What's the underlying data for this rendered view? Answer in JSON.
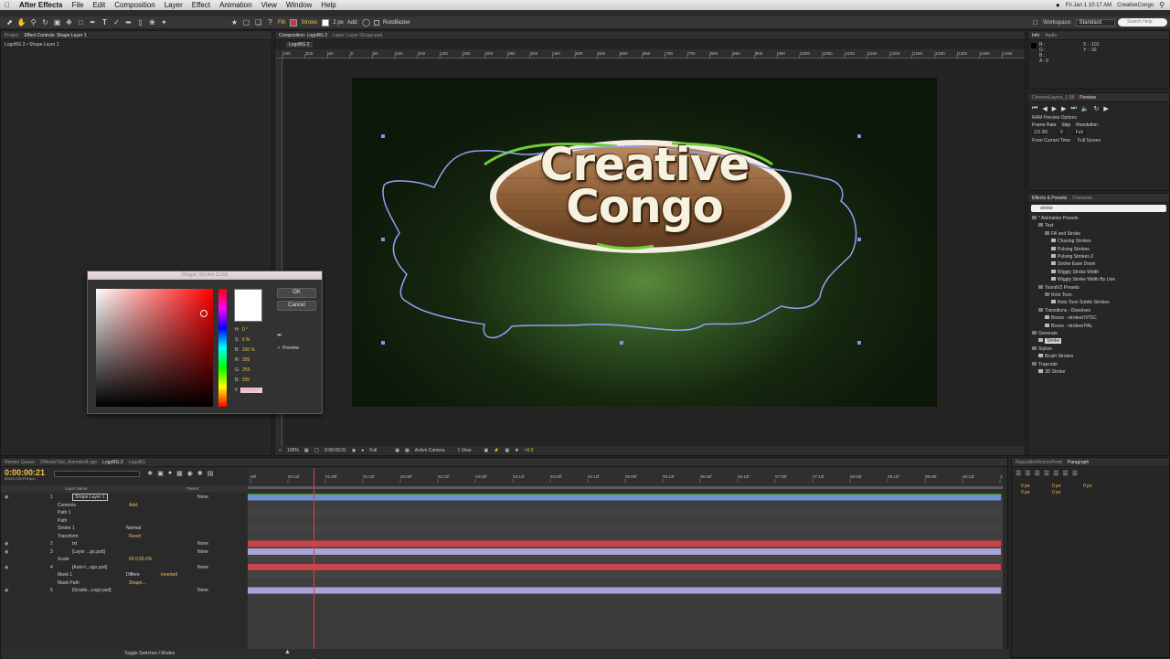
{
  "menubar": {
    "apple": "",
    "app_name": "After Effects",
    "items": [
      "File",
      "Edit",
      "Composition",
      "Layer",
      "Effect",
      "Animation",
      "View",
      "Window",
      "Help"
    ],
    "clock": "Fri Jan 1 10:17 AM",
    "user": "CreativeCongo"
  },
  "toolbar": {
    "fill_label": "Fill:",
    "stroke_label": "Stroke:",
    "stroke_width": "2 px",
    "add_label": "Add:",
    "rotobezier_label": "RotoBezier",
    "workspace_label": "Workspace:",
    "workspace_value": "Standard",
    "search_placeholder": "Search Help"
  },
  "project_panel": {
    "tabs": [
      "Project",
      "Effect Controls: Shape Layer 1"
    ],
    "breadcrumb": "LogoBG 2 • Shape Layer 1"
  },
  "composition_panel": {
    "tabs": [
      "Composition: LogoBG 2",
      "Layer: Layer 0/Logo.psd"
    ],
    "sub_tab": "LogoBG 2",
    "ruler_labels": [
      "|150",
      "|100",
      "|50",
      "|0",
      "|50",
      "|100",
      "|150",
      "|200",
      "|250",
      "|300",
      "|350",
      "|400",
      "|450",
      "|500",
      "|550",
      "|600",
      "|650",
      "|700",
      "|750",
      "|800",
      "|850",
      "|900",
      "|950",
      "|1000",
      "|1050",
      "|1100",
      "|1150",
      "|1200",
      "|1250",
      "|1300",
      "|1350",
      "|1400",
      "|1450"
    ],
    "logo_line1": "Creative",
    "logo_line2": "Congo",
    "footer": {
      "zoom": "100%",
      "timecode": "0:00:00:21",
      "resolution": "Full",
      "camera": "Active Camera",
      "view": "1 View",
      "exposure": "+0.0"
    }
  },
  "color_dialog": {
    "title": "Shape Stroke Color",
    "ok_label": "OK",
    "cancel_label": "Cancel",
    "preview_label": "Preview",
    "fields": [
      {
        "key": "H:",
        "value": "0 °"
      },
      {
        "key": "S:",
        "value": "0 %"
      },
      {
        "key": "B:",
        "value": "100 %"
      },
      {
        "key": "R:",
        "value": "255"
      },
      {
        "key": "G:",
        "value": "255"
      },
      {
        "key": "B:",
        "value": "255"
      }
    ],
    "hex_value": "FFFFFF",
    "current_color": "#ffffff"
  },
  "info_panel": {
    "tabs": [
      "Info",
      "Audio"
    ],
    "r": "R :",
    "g": "G :",
    "b": "B :",
    "a": "A : 0",
    "x": "X : -101",
    "y": "Y : -32"
  },
  "preview_panel": {
    "tabs": [
      "ConnectLayers_1.08",
      "Preview"
    ],
    "ram_options": "RAM Preview Options",
    "frame_rate_label": "Frame Rate",
    "skip_label": "Skip",
    "resolution_label": "Resolution",
    "frame_rate_value": "(23.98)",
    "skip_value": "0",
    "resolution_value": "Full",
    "from_current": "From Current Time",
    "full_screen": "Full Screen"
  },
  "effects_panel": {
    "tabs": [
      "Effects & Presets",
      "Character"
    ],
    "search_value": "stroke",
    "tree": [
      {
        "level": 0,
        "label": "* Animation Presets",
        "folder": true
      },
      {
        "level": 1,
        "label": "Text",
        "folder": true
      },
      {
        "level": 2,
        "label": "Fill and Stroke",
        "folder": true
      },
      {
        "level": 3,
        "label": "Chasing Strokes",
        "folder": false
      },
      {
        "level": 3,
        "label": "Pulsing Strokes",
        "folder": false
      },
      {
        "level": 3,
        "label": "Pulsing Strokes 2",
        "folder": false
      },
      {
        "level": 3,
        "label": "Stroke Ease Down",
        "folder": false
      },
      {
        "level": 3,
        "label": "Wiggly Stroke Width",
        "folder": false
      },
      {
        "level": 3,
        "label": "Wiggly Stroke Width By Line",
        "folder": false
      },
      {
        "level": 1,
        "label": "ToonitV2 Presets",
        "folder": true
      },
      {
        "level": 2,
        "label": "Roto Toon",
        "folder": true
      },
      {
        "level": 3,
        "label": "Roto Toon Subtle Strokes",
        "folder": false
      },
      {
        "level": 1,
        "label": "Transitions - Dissolves",
        "folder": true
      },
      {
        "level": 2,
        "label": "Boxes - stroked NTSC",
        "folder": false
      },
      {
        "level": 2,
        "label": "Boxes - stroked PAL",
        "folder": false
      },
      {
        "level": 0,
        "label": "Generate",
        "folder": true
      },
      {
        "level": 1,
        "label": "Stroke",
        "folder": false,
        "selected": true
      },
      {
        "level": 0,
        "label": "Stylize",
        "folder": true
      },
      {
        "level": 1,
        "label": "Brush Strokes",
        "folder": false
      },
      {
        "level": 0,
        "label": "Trapcode",
        "folder": true
      },
      {
        "level": 1,
        "label": "3D Stroke",
        "folder": false
      }
    ]
  },
  "timeline": {
    "tabs": [
      "Render Queue",
      "2MinuteTuts_AnimatedLogo",
      "LogoBG 2",
      "LogoBG"
    ],
    "current_time": "0:00:00:21",
    "fps_info": "00021 (23.976 fps)",
    "col_layer_name": "Layer Name",
    "col_parent": "Parent",
    "time_labels": [
      "00f",
      "00:12f",
      "01:00f",
      "01:12f",
      "02:00f",
      "02:12f",
      "03:00f",
      "03:12f",
      "04:00f",
      "04:12f",
      "05:00f",
      "05:12f",
      "06:00f",
      "06:12f",
      "07:00f",
      "07:12f",
      "08:00f",
      "08:12f",
      "09:00f",
      "09:12f",
      "10:0"
    ],
    "rows": [
      {
        "num": "1",
        "name": "Shape Layer 1",
        "parent": "None"
      },
      {
        "name": "Contents",
        "extra": "Add:"
      },
      {
        "name": "Path 1"
      },
      {
        "name": "Path"
      },
      {
        "name": "Stroke 1",
        "mode": "Normal"
      },
      {
        "name": "Transform",
        "extra": "Reset"
      },
      {
        "num": "2",
        "name": "txt",
        "parent": "None"
      },
      {
        "num": "3",
        "name": "[Layer ...go.psd]",
        "parent": "None"
      },
      {
        "name": "Scale",
        "extra": "65.0,65.0%"
      },
      {
        "num": "4",
        "name": "[Auto-t...ogo.psd]",
        "parent": "None"
      },
      {
        "name": "Mask 1",
        "mode": "Differe",
        "extra": "Inverted"
      },
      {
        "name": "Mask Path",
        "extra": "Shape..."
      },
      {
        "num": "5",
        "name": "[Gradie...Logo.psd]",
        "parent": "None"
      }
    ],
    "toggle_label": "Toggle Switches / Modes"
  },
  "paragraph_panel": {
    "tabs": [
      "RepositionAnchorPoint",
      "Paragraph"
    ],
    "values": [
      "0 px",
      "0 px",
      "0 px",
      "0 px",
      "0 px"
    ]
  },
  "colors": {
    "accent_yellow": "#f3c242",
    "timeline_red": "#c8444a",
    "timeline_lavender": "#a9a3d6",
    "timeline_blue": "#6c8fd6",
    "timeline_green": "#5faa5f",
    "path_stroke": "#8ea2f5"
  }
}
